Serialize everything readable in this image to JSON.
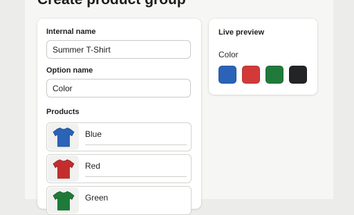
{
  "page": {
    "title": "Create product group"
  },
  "form": {
    "internal_name_label": "Internal name",
    "internal_name_value": "Summer T-Shirt",
    "option_name_label": "Option name",
    "option_name_value": "Color",
    "products_label": "Products",
    "products": [
      {
        "name": "Blue",
        "color": "#2a63b7",
        "icon": "tshirt-icon"
      },
      {
        "name": "Red",
        "color": "#c42d2d",
        "icon": "tshirt-icon"
      },
      {
        "name": "Green",
        "color": "#1f7a3a",
        "icon": "tshirt-icon"
      }
    ]
  },
  "preview": {
    "title": "Live preview",
    "option_label": "Color",
    "swatches": [
      {
        "name": "Blue",
        "color": "#2a63b7"
      },
      {
        "name": "Red",
        "color": "#d23a3a"
      },
      {
        "name": "Green",
        "color": "#217a3c"
      },
      {
        "name": "Black",
        "color": "#222426"
      }
    ]
  }
}
